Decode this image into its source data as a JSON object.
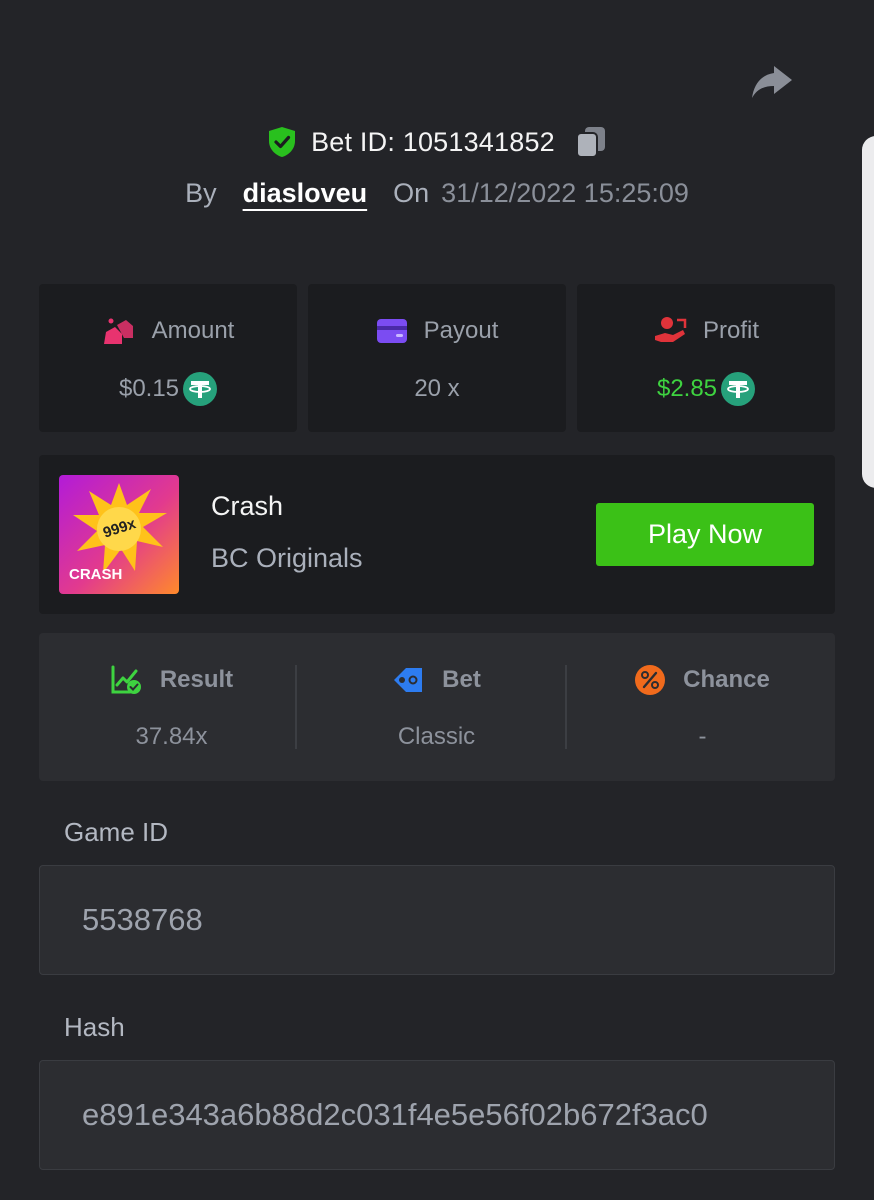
{
  "header": {
    "bet_id_label": "Bet ID: 1051341852",
    "by_label": "By",
    "username": "diasloveu",
    "on_label": "On",
    "datetime": "31/12/2022 15:25:09",
    "icons": {
      "share": "share-icon",
      "verified": "verified-shield-icon",
      "copy": "copy-icon"
    }
  },
  "stats": {
    "amount": {
      "label": "Amount",
      "value": "$0.15",
      "currency_icon": "usdt-icon"
    },
    "payout": {
      "label": "Payout",
      "value": "20 x"
    },
    "profit": {
      "label": "Profit",
      "value": "$2.85",
      "currency_icon": "usdt-icon"
    }
  },
  "game": {
    "thumb_multiplier": "999x",
    "thumb_title": "CRASH",
    "name": "Crash",
    "provider": "BC Originals",
    "play_label": "Play Now"
  },
  "result_panel": {
    "result": {
      "label": "Result",
      "value": "37.84x"
    },
    "bet": {
      "label": "Bet",
      "value": "Classic"
    },
    "chance": {
      "label": "Chance",
      "value": "-"
    }
  },
  "fields": {
    "game_id": {
      "label": "Game ID",
      "value": "5538768"
    },
    "hash": {
      "label": "Hash",
      "value": "e891e343a6b88d2c031f4e5e56f02b672f3ac0"
    }
  },
  "colors": {
    "background": "#232428",
    "card": "#1b1c1f",
    "panel": "#2c2d31",
    "accent_green": "#3bc117",
    "profit_green": "#3ed340",
    "amount_pink": "#e8336f",
    "payout_purple": "#7b4cf2",
    "profit_red": "#e0333a",
    "bet_blue": "#2d7cf0",
    "chance_orange": "#f06a1c",
    "tether_green": "#26a17b"
  }
}
